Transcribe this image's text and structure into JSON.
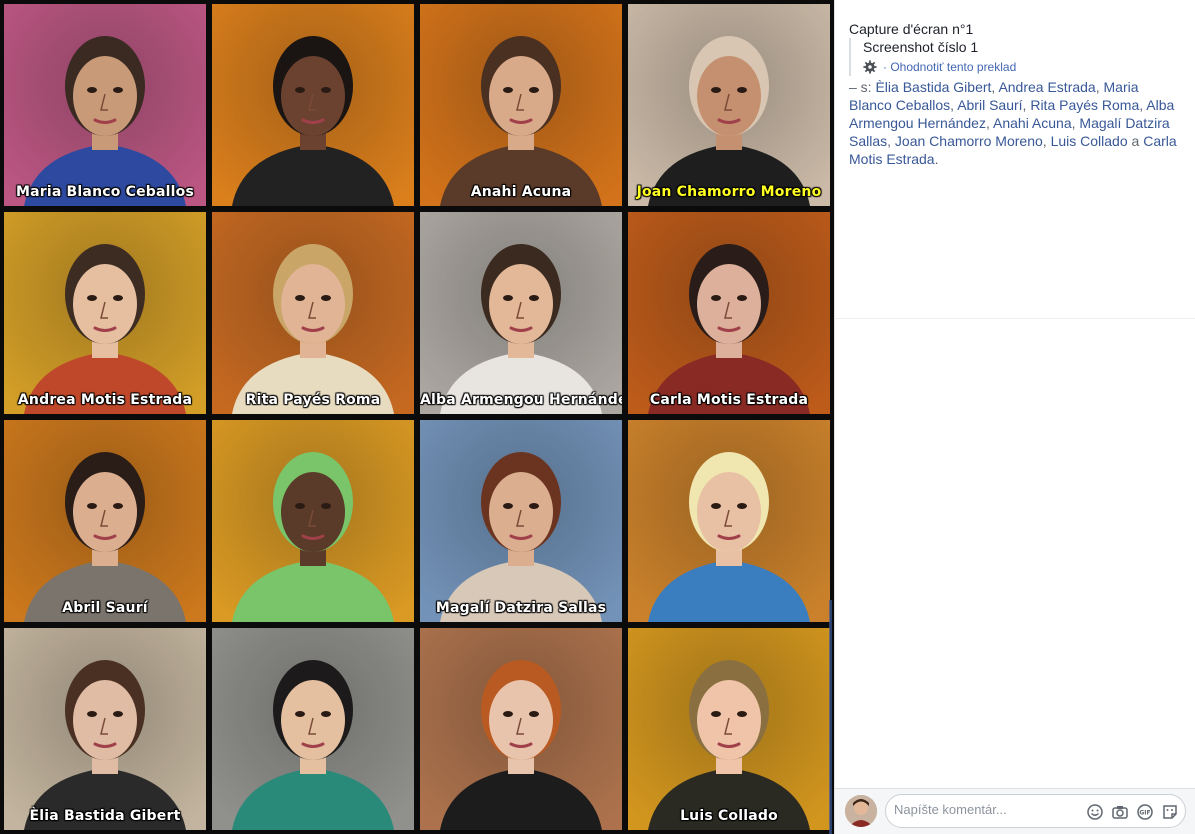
{
  "tiles": [
    {
      "name": "Maria Blanco Ceballos",
      "bg": "#c85d8c",
      "skin": "#c89a78",
      "hair": "#3a2a22",
      "cloth": "#2d4aa0"
    },
    {
      "name": "",
      "bg": "#e8871e",
      "skin": "#6b4230",
      "hair": "#1a1412",
      "cloth": "#222222"
    },
    {
      "name": "Anahi Acuna",
      "bg": "#e07a1c",
      "skin": "#d9aa8a",
      "hair": "#4a3020",
      "cloth": "#5a3a28"
    },
    {
      "name": "Joan Chamorro Moreno",
      "bg": "#d8c6b2",
      "skin": "#c59070",
      "hair": "#d8c6b2",
      "cloth": "#1e1e1e",
      "highlight": true
    },
    {
      "name": "Andrea Motis Estrada",
      "bg": "#e1a92a",
      "skin": "#e5bfa0",
      "hair": "#3c2c22",
      "cloth": "#c0482a"
    },
    {
      "name": "Rita Payés Roma",
      "bg": "#d27024",
      "skin": "#e0b494",
      "hair": "#c9a568",
      "cloth": "#e8dcc0"
    },
    {
      "name": "Alba Armengou Hernández",
      "bg": "#b8b2ac",
      "skin": "#e3b898",
      "hair": "#3a2a20",
      "cloth": "#e8e4e0"
    },
    {
      "name": "Carla Motis Estrada",
      "bg": "#c9611c",
      "skin": "#dcb09a",
      "hair": "#2a1c18",
      "cloth": "#8a2a24"
    },
    {
      "name": "Abril Saurí",
      "bg": "#d9801e",
      "skin": "#dcae90",
      "hair": "#2a1c16",
      "cloth": "#7a746c"
    },
    {
      "name": "",
      "bg": "#e8a426",
      "skin": "#5a3a28",
      "hair": "#7ac46a",
      "cloth": "#7ac46a"
    },
    {
      "name": "Magalí Datzira Sallas",
      "bg": "#7a9cc4",
      "skin": "#dcae90",
      "hair": "#6a3420",
      "cloth": "#d8c8b8"
    },
    {
      "name": "",
      "bg": "#d88a2e",
      "skin": "#e8c0a4",
      "hair": "#f0e6b0",
      "cloth": "#3a7ec0"
    },
    {
      "name": "Èlia Bastida Gibert",
      "bg": "#cfc0a8",
      "skin": "#e0bca4",
      "hair": "#4a3022",
      "cloth": "#2a2a2a"
    },
    {
      "name": "",
      "bg": "#9a9a96",
      "skin": "#e4c0a0",
      "hair": "#1c1a1a",
      "cloth": "#2a8a7a"
    },
    {
      "name": "",
      "bg": "#b87a52",
      "skin": "#e8c4ac",
      "hair": "#b85a22",
      "cloth": "#1c1c1c"
    },
    {
      "name": "Luis Collado",
      "bg": "#e0a020",
      "skin": "#efc4a8",
      "hair": "#8a7040",
      "cloth": "#2a2a22"
    }
  ],
  "side": {
    "caption": "Capture d'écran n°1",
    "translation": "Screenshot číslo 1",
    "rate_translation": "· Ohodnotiť tento preklad",
    "tags_prefix": "– s: ",
    "tags": [
      "Èlia Bastida Gibert",
      "Andrea Estrada",
      "Maria Blanco Ceballos",
      "Abril Saurí",
      "Rita Payés Roma",
      "Alba Armengou Hernández",
      "Anahi Acuna",
      "Magalí Datzira Sallas",
      "Joan Chamorro Moreno",
      "Luis Collado"
    ],
    "tags_last_joiner": " a ",
    "tags_last": "Carla Motis Estrada",
    "tags_end": "."
  },
  "comment": {
    "placeholder": "Napíšte komentár...",
    "icons": [
      "emoji-icon",
      "camera-icon",
      "gif-icon",
      "sticker-icon"
    ]
  },
  "colors": {
    "link": "#385898",
    "accent": "#4267b2"
  }
}
